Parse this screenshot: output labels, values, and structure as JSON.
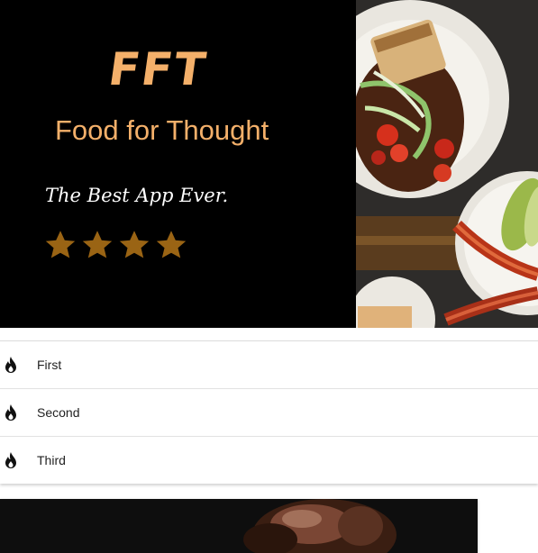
{
  "hero": {
    "logo": "FFT",
    "title": "Food for Thought",
    "tagline": "The Best App Ever.",
    "rating": 4,
    "star_color": "#9a6414",
    "accent": "#f4b06a",
    "photo_icon": "food-plate-photo"
  },
  "list": {
    "items": [
      {
        "label": "First",
        "icon": "flame-icon"
      },
      {
        "label": "Second",
        "icon": "flame-icon"
      },
      {
        "label": "Third",
        "icon": "flame-icon"
      }
    ]
  },
  "card": {
    "image": "dessert-photo"
  }
}
